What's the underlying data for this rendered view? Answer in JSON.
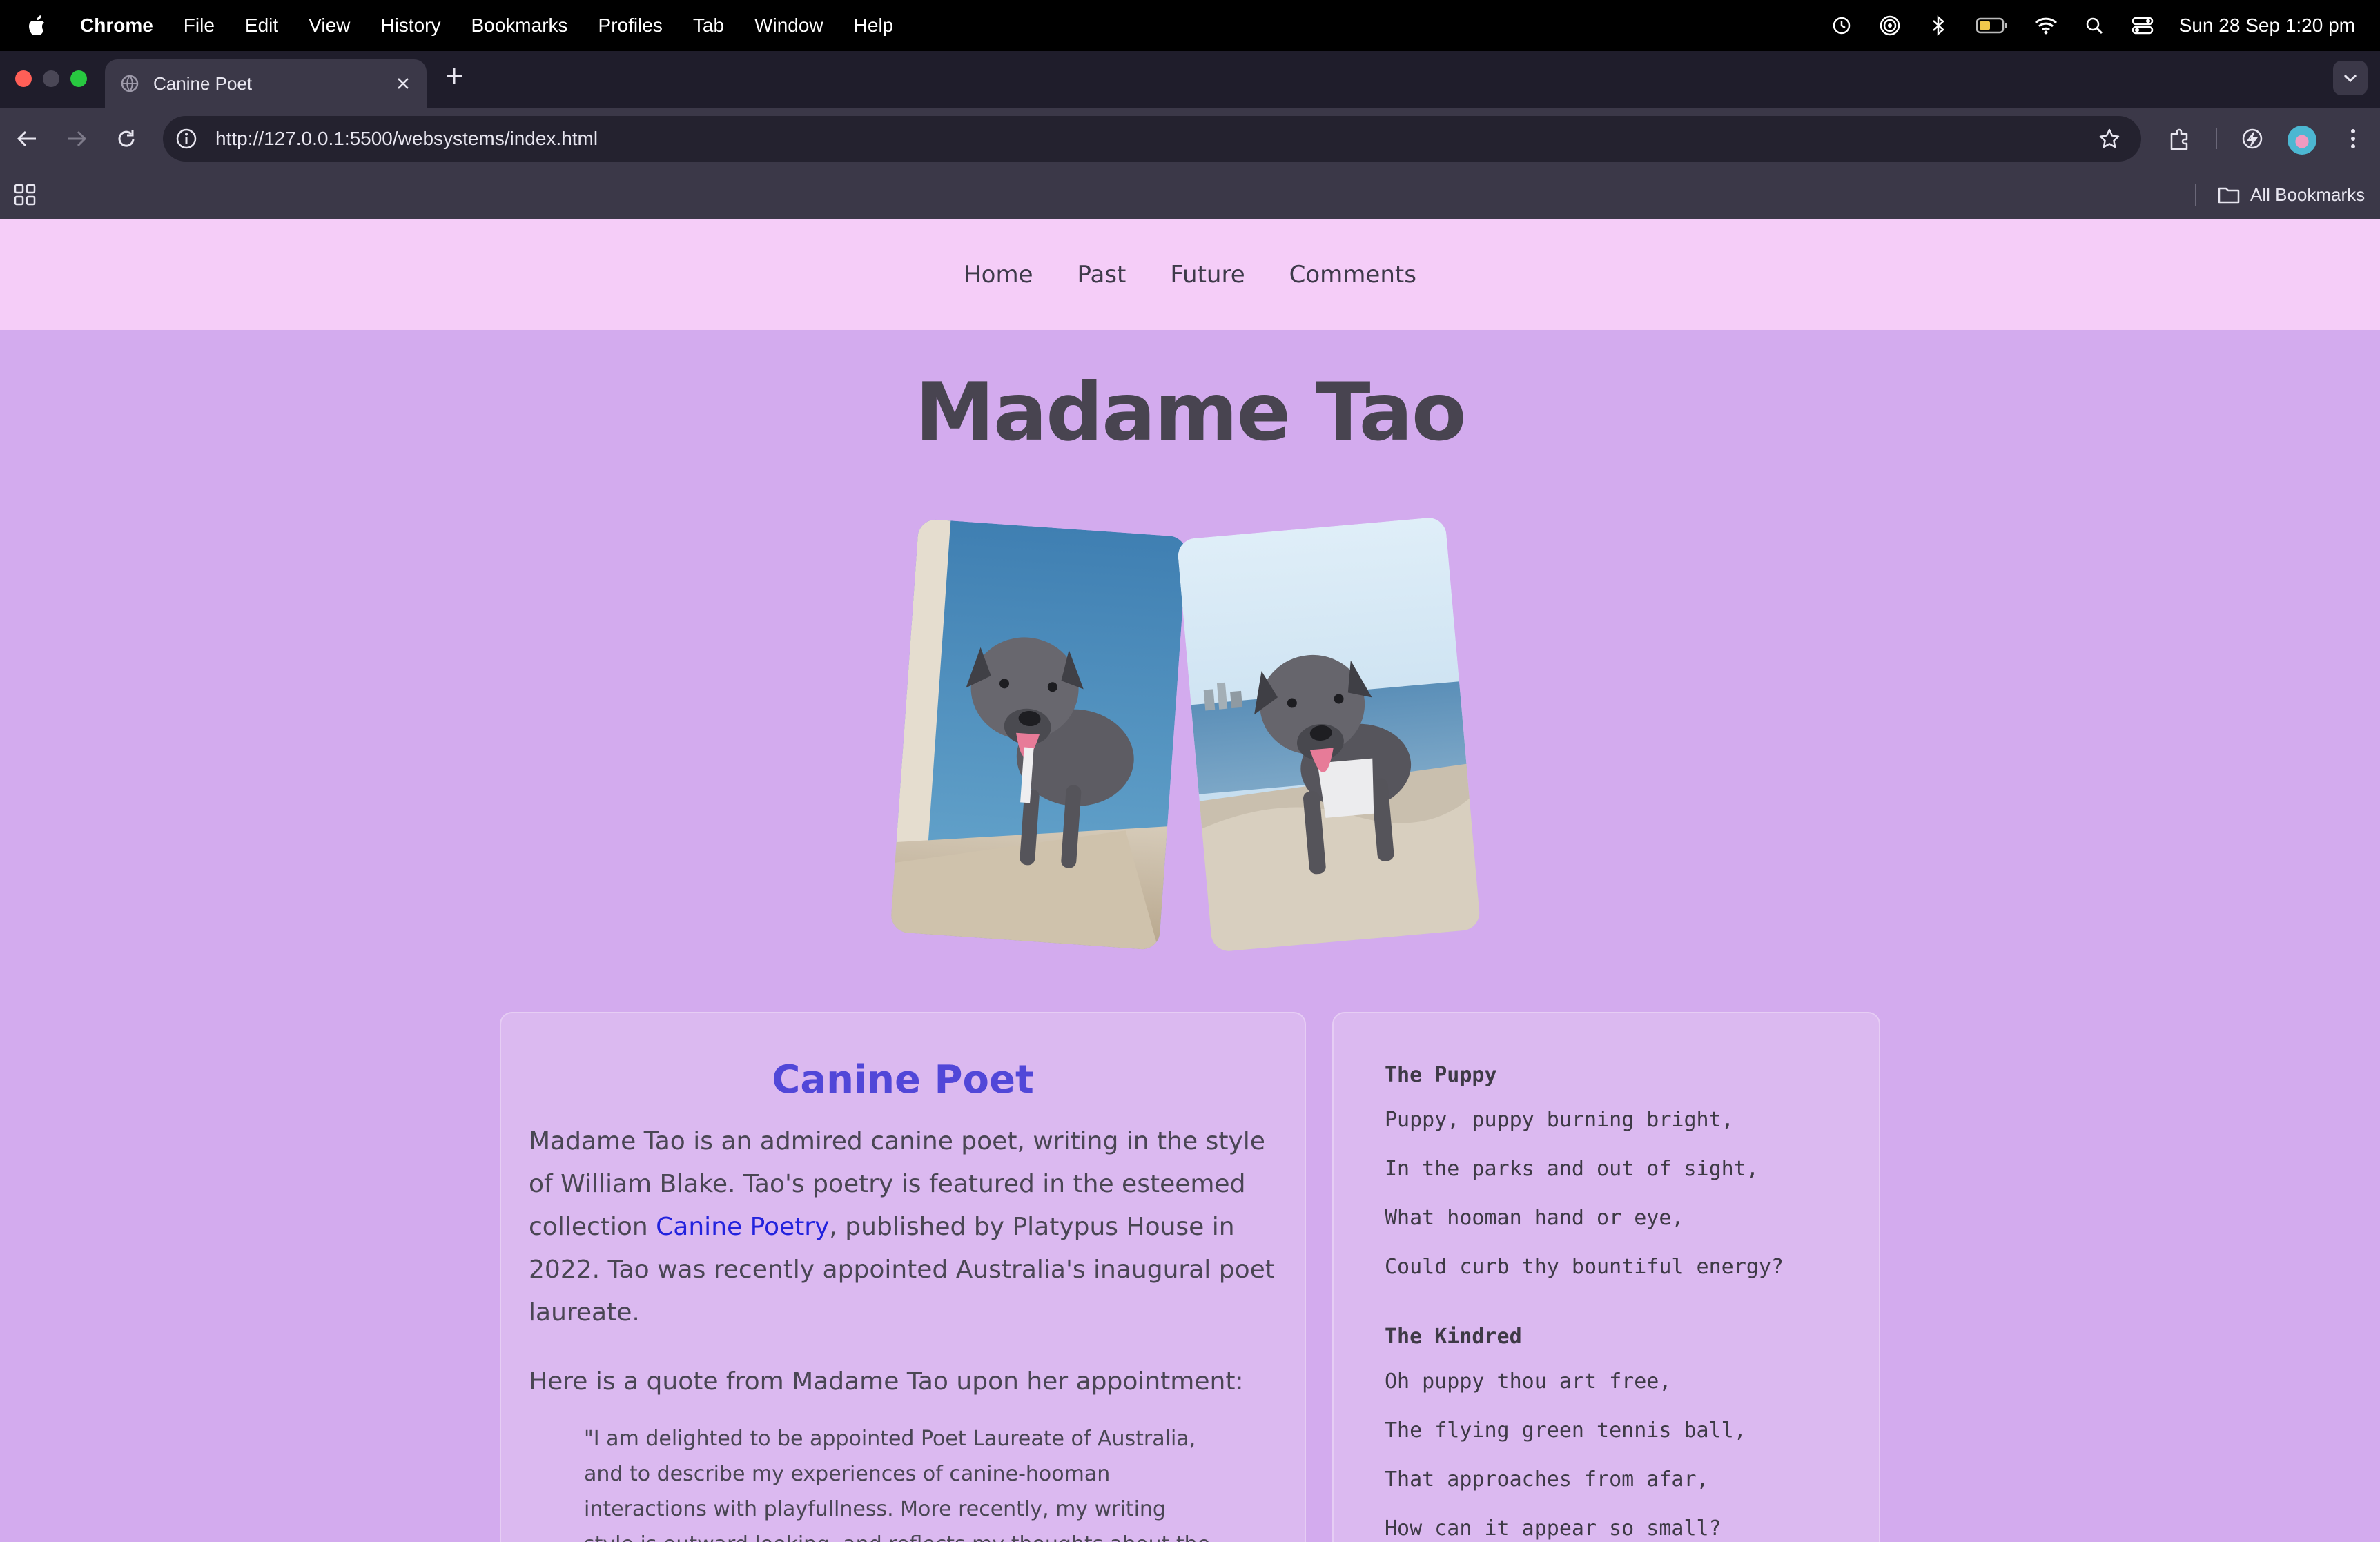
{
  "menubar": {
    "app": "Chrome",
    "items": [
      "File",
      "Edit",
      "View",
      "History",
      "Bookmarks",
      "Profiles",
      "Tab",
      "Window",
      "Help"
    ],
    "clock": "Sun 28 Sep  1:20 pm"
  },
  "browser": {
    "tab_title": "Canine Poet",
    "url": "http://127.0.0.1:5500/websystems/index.html",
    "all_bookmarks": "All Bookmarks"
  },
  "site": {
    "nav": [
      "Home",
      "Past",
      "Future",
      "Comments"
    ],
    "title": "Madame Tao",
    "card": {
      "heading": "Canine Poet",
      "para_before_link": "Madame Tao is an admired canine poet, writing in the style of William Blake. Tao's poetry is featured in the esteemed collection ",
      "link": "Canine Poetry",
      "para_after_link": ", published by Platypus House in 2022. Tao was recently appointed Australia's inaugural poet laureate.",
      "quote_intro": "Here is a quote from Madame Tao upon her appointment:",
      "quote": "\"I am delighted to be appointed Poet Laureate of Australia, and to describe my experiences of canine-hooman interactions with playfullness. More recently, my writing style is outward looking, and reflects my thoughts about the universe.\""
    },
    "poems": [
      {
        "title": "The Puppy",
        "lines": [
          "Puppy, puppy burning bright,",
          "In the parks and out of sight,",
          "What hooman hand or eye,",
          "Could curb thy bountiful energy?"
        ]
      },
      {
        "title": "The Kindred",
        "lines": [
          "Oh puppy thou art free,",
          "The flying green tennis ball,",
          "That approaches from afar,",
          "How can it appear so small?"
        ]
      }
    ]
  }
}
